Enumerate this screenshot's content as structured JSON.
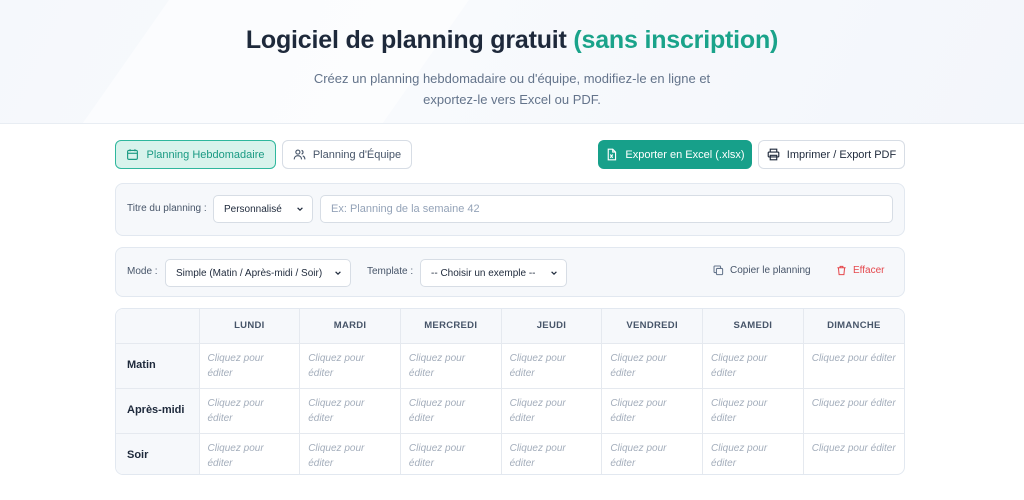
{
  "hero": {
    "title_main": "Logiciel de planning gratuit ",
    "title_accent": "(sans inscription)",
    "subtitle": "Créez un planning hebdomadaire ou d'équipe, modifiez-le en ligne et exportez-le vers Excel ou PDF."
  },
  "tabs": {
    "weekly": "Planning Hebdomadaire",
    "team": "Planning d'Équipe"
  },
  "actions": {
    "export_excel": "Exporter en Excel (.xlsx)",
    "print_pdf": "Imprimer / Export PDF"
  },
  "title_row": {
    "label": "Titre du planning :",
    "select_value": "Personnalisé",
    "input_placeholder": "Ex: Planning de la semaine 42"
  },
  "mode_row": {
    "mode_label": "Mode :",
    "mode_value": "Simple (Matin / Après-midi / Soir)",
    "template_label": "Template :",
    "template_value": "-- Choisir un exemple --",
    "copy_label": "Copier le planning",
    "clear_label": "Effacer"
  },
  "grid": {
    "days": [
      "LUNDI",
      "MARDI",
      "MERCREDI",
      "JEUDI",
      "VENDREDI",
      "SAMEDI",
      "DIMANCHE"
    ],
    "rows": [
      "Matin",
      "Après-midi",
      "Soir"
    ],
    "cell_placeholder": "Cliquez pour éditer"
  },
  "colors": {
    "accent": "#1aa38a",
    "danger": "#e5484d"
  }
}
